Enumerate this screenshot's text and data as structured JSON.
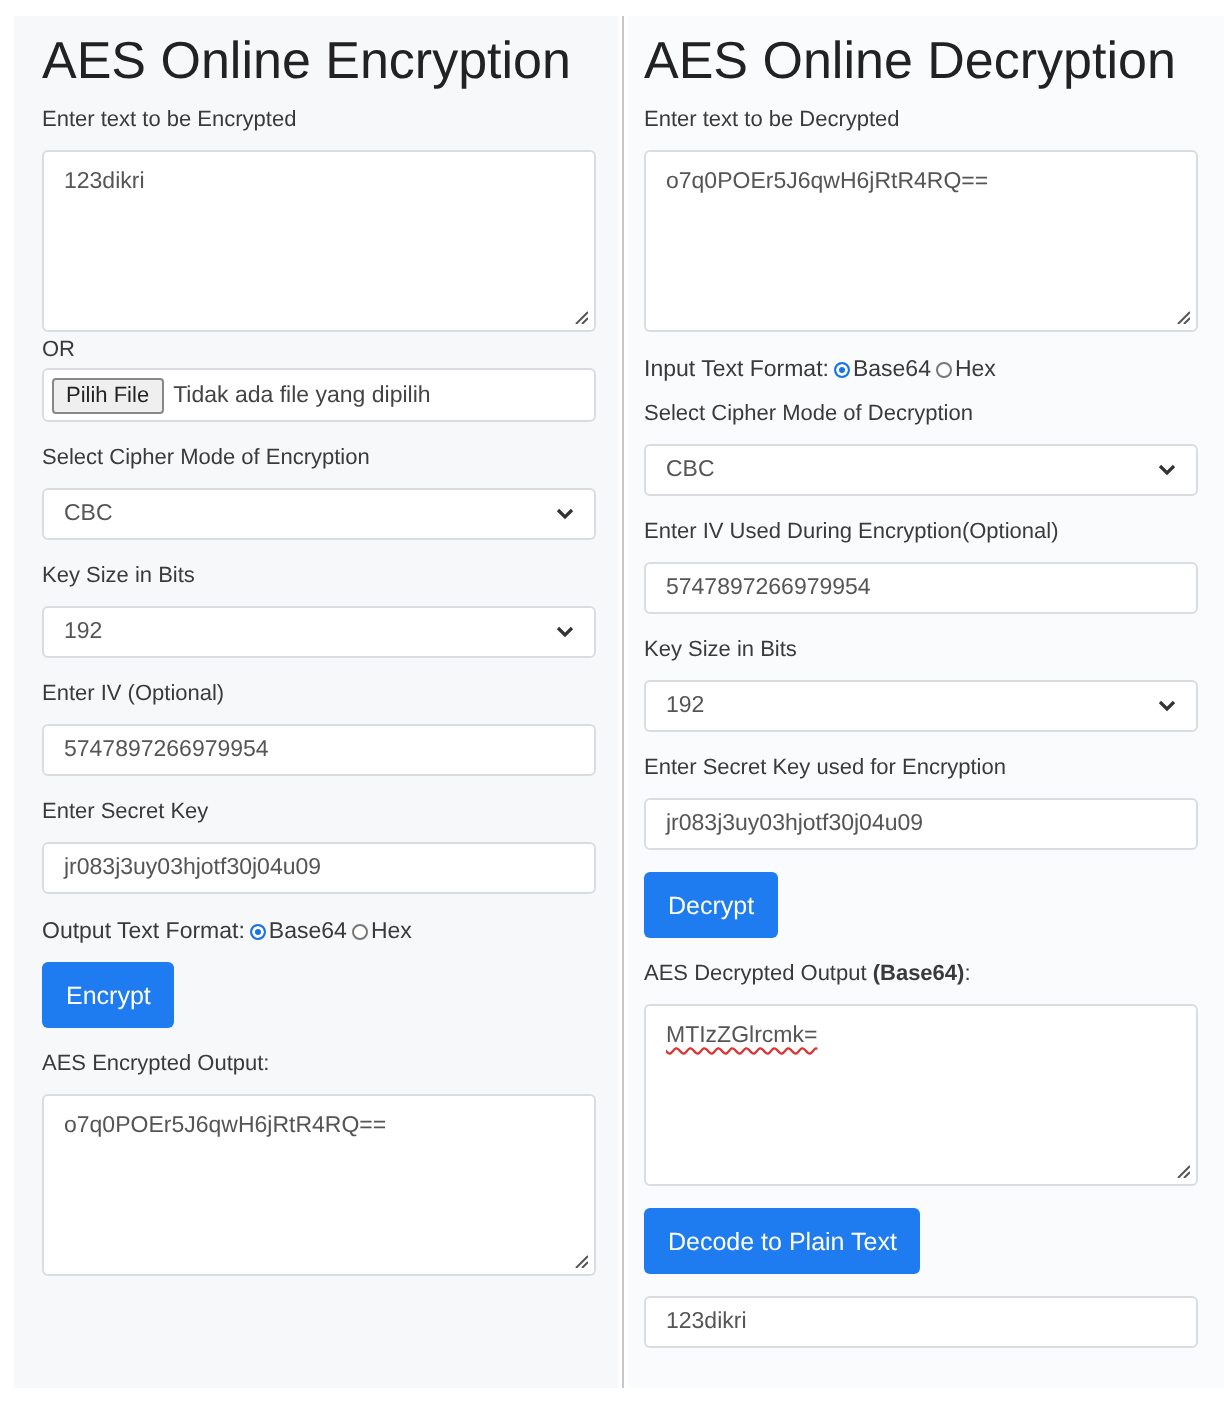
{
  "panels": [
    {
      "title": "AES Online Encryption",
      "items": [
        {
          "kind": "label",
          "text": "Enter text to be Encrypted"
        },
        {
          "kind": "textarea",
          "value": "123dikri",
          "misspelled": false
        },
        {
          "kind": "or",
          "text": "OR"
        },
        {
          "kind": "file",
          "button": "Pilih File",
          "text": "Tidak ada file yang dipilih"
        },
        {
          "kind": "label",
          "text": "Select Cipher Mode of Encryption"
        },
        {
          "kind": "select",
          "value": "CBC"
        },
        {
          "kind": "label",
          "text": "Key Size in Bits"
        },
        {
          "kind": "select",
          "value": "192"
        },
        {
          "kind": "label",
          "text": "Enter IV (Optional)"
        },
        {
          "kind": "input",
          "value": "5747897266979954"
        },
        {
          "kind": "label",
          "text": "Enter Secret Key"
        },
        {
          "kind": "input",
          "value": "jr083j3uy03hjotf30j04u09"
        },
        {
          "kind": "radio",
          "text": "Output Text Format:",
          "options": [
            {
              "label": "Base64",
              "selected": true
            },
            {
              "label": "Hex",
              "selected": false
            }
          ]
        },
        {
          "kind": "button",
          "text": "Encrypt"
        },
        {
          "kind": "label",
          "text": "AES Encrypted Output:"
        },
        {
          "kind": "textarea",
          "value": "o7q0POEr5J6qwH6jRtR4RQ==",
          "misspelled": false
        }
      ]
    },
    {
      "title": "AES Online Decryption",
      "items": [
        {
          "kind": "label",
          "text": "Enter text to be Decrypted"
        },
        {
          "kind": "textarea",
          "value": "o7q0POEr5J6qwH6jRtR4RQ==",
          "misspelled": false
        },
        {
          "kind": "radio",
          "text": "Input Text Format:",
          "options": [
            {
              "label": "Base64",
              "selected": true
            },
            {
              "label": "Hex",
              "selected": false
            }
          ]
        },
        {
          "kind": "label",
          "text": "Select Cipher Mode of Decryption"
        },
        {
          "kind": "select",
          "value": "CBC"
        },
        {
          "kind": "label",
          "text": "Enter IV Used During Encryption(Optional)"
        },
        {
          "kind": "input",
          "value": "5747897266979954"
        },
        {
          "kind": "label",
          "text": "Key Size in Bits"
        },
        {
          "kind": "select",
          "value": "192"
        },
        {
          "kind": "label",
          "text": "Enter Secret Key used for Encryption"
        },
        {
          "kind": "input",
          "value": "jr083j3uy03hjotf30j04u09"
        },
        {
          "kind": "button",
          "text": "Decrypt"
        },
        {
          "kind": "label",
          "text": "AES Decrypted Output **(Base64)**:"
        },
        {
          "kind": "textarea",
          "value": "MTIzZGlrcmk=",
          "misspelled": true
        },
        {
          "kind": "button",
          "text": "Decode to Plain Text"
        },
        {
          "kind": "input",
          "value": "123dikri"
        }
      ]
    }
  ]
}
